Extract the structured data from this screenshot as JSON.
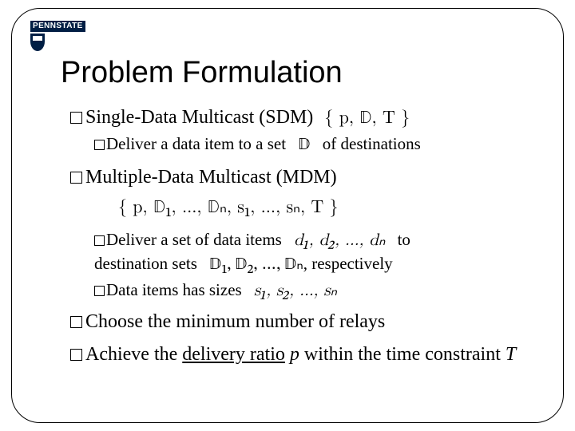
{
  "logo": {
    "text": "PENNSTATE"
  },
  "title": "Problem Formulation",
  "bullets": {
    "sdm": {
      "label": "Single-Data Multicast (SDM)",
      "tuple": "{ p, 𝔻, T }",
      "sub1_a": "Deliver a data item to a set",
      "sub1_sym": "𝔻",
      "sub1_b": "of destinations"
    },
    "mdm": {
      "label": "Multiple-Data Multicast (MDM)",
      "tuple": "{ p, 𝔻₁, …, 𝔻ₙ, s₁, …, sₙ, T }",
      "sub1_a": "Deliver a set of data items",
      "sub1_sym": "d₁, d₂, …, dₙ",
      "sub1_b": "to",
      "sub1_c": "destination sets",
      "sub1_sym2": "𝔻₁, 𝔻₂, …, 𝔻ₙ",
      "sub1_d": ", respectively",
      "sub2_a": "Data items has sizes",
      "sub2_sym": "s₁, s₂, …, sₙ"
    },
    "choose": "Choose the minimum number of relays",
    "achieve_a": "Achieve the ",
    "achieve_link": "delivery ratio",
    "achieve_b": " ",
    "achieve_p": "p",
    "achieve_c": " within the time constraint ",
    "achieve_T": "T"
  }
}
